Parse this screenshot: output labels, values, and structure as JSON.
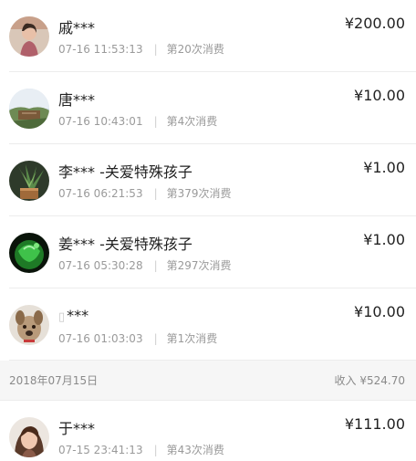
{
  "transactions": [
    {
      "name": "戚***",
      "time": "07-16 11:53:13",
      "count": "第20次消费",
      "amount": "¥200.00",
      "avatar_icon": "avatar-woman-icon",
      "avatar_color": "#b0606a"
    },
    {
      "name": "唐***",
      "time": "07-16 10:43:01",
      "count": "第4次消费",
      "amount": "¥10.00",
      "avatar_icon": "avatar-landscape-icon",
      "avatar_color": "#7aa4c8"
    },
    {
      "name": "李*** -关爱特殊孩子",
      "time": "07-16 06:21:53",
      "count": "第379次消费",
      "amount": "¥1.00",
      "avatar_icon": "avatar-plant-icon",
      "avatar_color": "#3b5e3a"
    },
    {
      "name": "姜*** -关爱特殊孩子",
      "time": "07-16 05:30:28",
      "count": "第297次消费",
      "amount": "¥1.00",
      "avatar_icon": "avatar-green-leaf-icon",
      "avatar_color": "#1e9a2a"
    },
    {
      "name": "***",
      "time": "07-16 01:03:03",
      "count": "第1次消费",
      "amount": "¥10.00",
      "avatar_icon": "avatar-pet-icon",
      "avatar_color": "#c8b8a8"
    }
  ],
  "date_group": {
    "date": "2018年07月15日",
    "income": "收入 ¥524.70"
  },
  "transactions_2": [
    {
      "name": "于***",
      "time": "07-15 23:41:13",
      "count": "第43次消费",
      "amount": "¥111.00",
      "avatar_icon": "avatar-woman-icon",
      "avatar_color": "#8a5a48"
    }
  ],
  "separator": "|"
}
